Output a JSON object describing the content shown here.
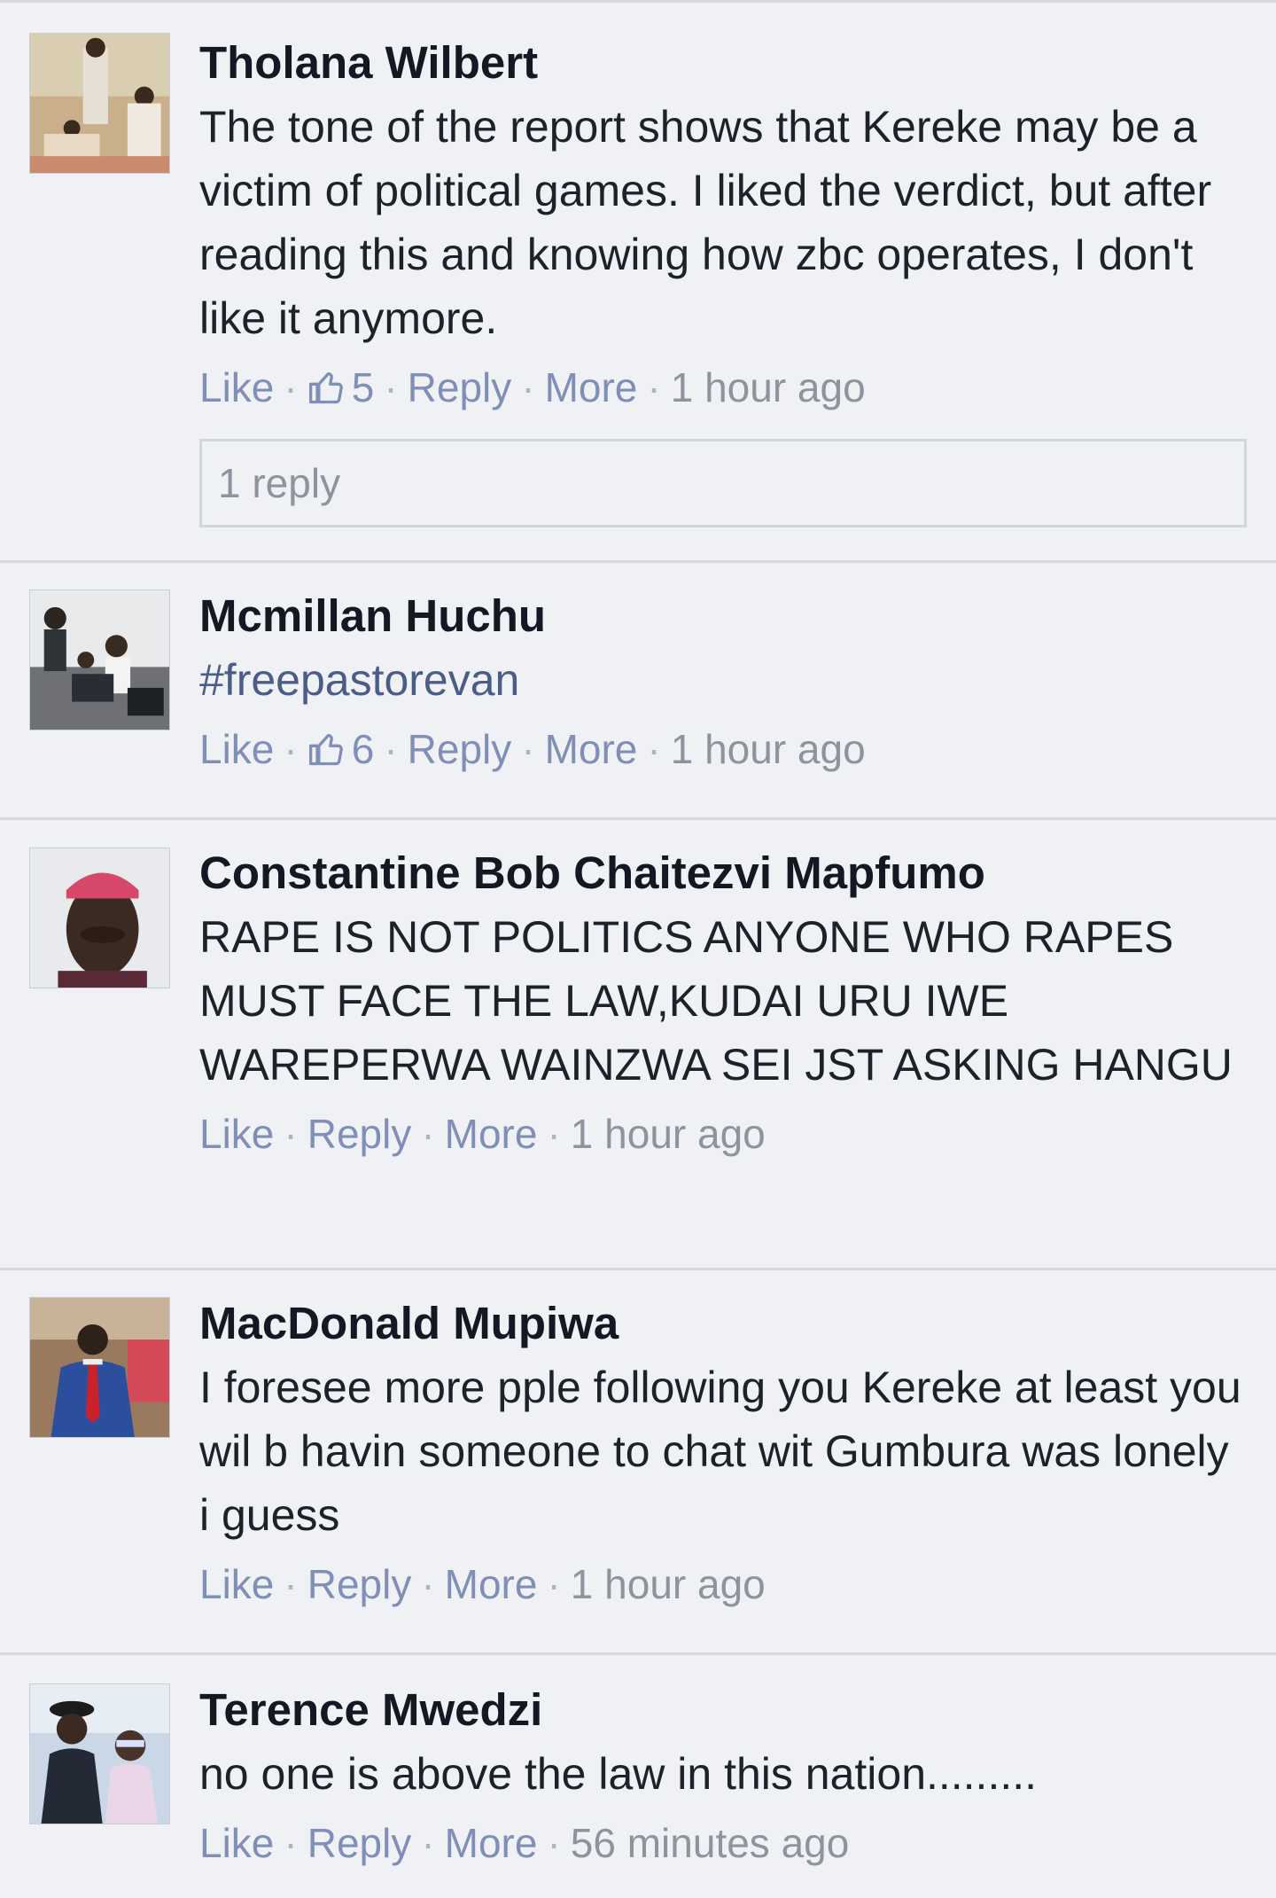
{
  "comments": [
    {
      "author": "Tholana Wilbert",
      "text": "The tone of the report shows that Kereke may be a victim of political games. I liked the verdict, but after reading this and knowing how zbc operates, I don't like it anymore.",
      "like_label": "Like",
      "like_count": "5",
      "reply_label": "Reply",
      "more_label": "More",
      "time": "1 hour ago",
      "replies_label": "1 reply",
      "avatar_icon": "profile-photo"
    },
    {
      "author": "Mcmillan Huchu",
      "text": "#freepastorevan",
      "like_label": "Like",
      "like_count": "6",
      "reply_label": "Reply",
      "more_label": "More",
      "time": "1 hour ago",
      "avatar_icon": "profile-photo"
    },
    {
      "author": "Constantine Bob Chaitezvi Mapfumo",
      "text": "RAPE IS NOT POLITICS ANYONE WHO RAPES MUST FACE THE LAW,KUDAI URU IWE WAREPERWA WAINZWA SEI JST ASKING HANGU",
      "like_label": "Like",
      "reply_label": "Reply",
      "more_label": "More",
      "time": "1 hour ago",
      "avatar_icon": "profile-photo"
    },
    {
      "author": "MacDonald Mupiwa",
      "text": "I foresee more pple following you Kereke at least you wil b havin someone to chat wit Gumbura was lonely i guess",
      "like_label": "Like",
      "reply_label": "Reply",
      "more_label": "More",
      "time": "1 hour ago",
      "avatar_icon": "profile-photo"
    },
    {
      "author": "Terence Mwedzi",
      "text": "no one is above the law in this nation.........",
      "like_label": "Like",
      "reply_label": "Reply",
      "more_label": "More",
      "time": "56 minutes ago",
      "avatar_icon": "profile-photo"
    }
  ],
  "colors": {
    "background": "#f0f1f5",
    "author": "#141823",
    "link": "#7f8fb5",
    "hashtag": "#4b5d86",
    "muted": "#8d949e",
    "divider": "#d6d8dd"
  }
}
